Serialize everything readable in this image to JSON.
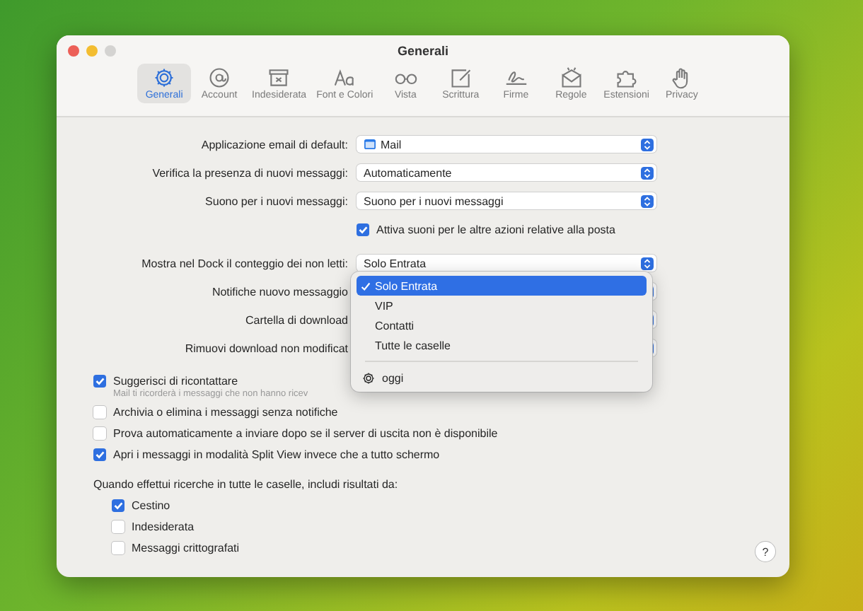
{
  "window": {
    "title": "Generali"
  },
  "toolbar": [
    {
      "label": "Generali",
      "selected": true
    },
    {
      "label": "Account",
      "selected": false
    },
    {
      "label": "Indesiderata",
      "selected": false
    },
    {
      "label": "Font e Colori",
      "selected": false
    },
    {
      "label": "Vista",
      "selected": false
    },
    {
      "label": "Scrittura",
      "selected": false
    },
    {
      "label": "Firme",
      "selected": false
    },
    {
      "label": "Regole",
      "selected": false
    },
    {
      "label": "Estensioni",
      "selected": false
    },
    {
      "label": "Privacy",
      "selected": false
    }
  ],
  "form": [
    {
      "kind": "popup",
      "label": "Applicazione email di default:",
      "value": "Mail",
      "app_icon": true
    },
    {
      "kind": "popup",
      "label": "Verifica la presenza di nuovi messaggi:",
      "value": "Automaticamente"
    },
    {
      "kind": "popup",
      "label": "Suono per i nuovi messaggi:",
      "value": "Suono per i nuovi messaggi"
    },
    {
      "kind": "check",
      "label": "Attiva suoni per le altre azioni relative alla posta",
      "checked": true
    },
    {
      "kind": "gap"
    },
    {
      "kind": "popup",
      "label": "Mostra nel Dock il conteggio dei non letti:",
      "value": "Solo Entrata"
    },
    {
      "kind": "popup",
      "label": "Notifiche nuovo messaggio"
    },
    {
      "kind": "popup",
      "label": "Cartella di download"
    },
    {
      "kind": "popup",
      "label": "Rimuovi download non modificat"
    }
  ],
  "options": [
    {
      "label": "Suggerisci di ricontattare",
      "checked": true,
      "hint": "Mail ti ricorderà i messaggi che non hanno ricev"
    },
    {
      "label": "Archivia o elimina i messaggi senza notifiche",
      "checked": false
    },
    {
      "label": "Prova automaticamente a inviare dopo se il server di uscita non è disponibile",
      "checked": false
    },
    {
      "label": "Apri i messaggi in modalità Split View invece che a tutto schermo",
      "checked": true
    }
  ],
  "search": {
    "heading": "Quando effettui ricerche in tutte le caselle, includi risultati da:",
    "items": [
      {
        "label": "Cestino",
        "checked": true
      },
      {
        "label": "Indesiderata",
        "checked": false
      },
      {
        "label": "Messaggi crittografati",
        "checked": false
      }
    ]
  },
  "menu": [
    {
      "kind": "option",
      "label": "Solo Entrata",
      "selected": true
    },
    {
      "kind": "option",
      "label": "VIP",
      "selected": false
    },
    {
      "kind": "option",
      "label": "Contatti",
      "selected": false
    },
    {
      "kind": "option",
      "label": "Tutte le caselle",
      "selected": false
    },
    {
      "kind": "gear",
      "label": "oggi",
      "selected": false
    }
  ],
  "help": {
    "label": "?"
  }
}
